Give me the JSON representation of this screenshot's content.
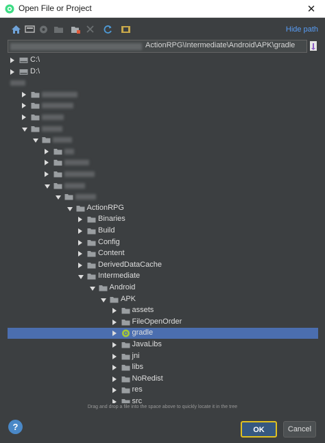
{
  "window": {
    "title": "Open File or Project",
    "close_glyph": "✕"
  },
  "toolbar": {
    "icons": [
      "home-icon",
      "desktop-icon",
      "android-icon",
      "project-folder-icon",
      "new-folder-icon",
      "delete-icon",
      "refresh-icon",
      "show-hidden-icon"
    ],
    "hide_path_label": "Hide path"
  },
  "path": {
    "visible_text": "ActionRPG\\Intermediate\\Android\\APK\\gradle"
  },
  "tree": {
    "rows": [
      {
        "label": "C:\\",
        "level": 0,
        "arrow": "right",
        "icon": "drive"
      },
      {
        "label": "D:\\",
        "level": 0,
        "arrow": "right",
        "icon": "drive"
      },
      {
        "label": "",
        "level": 0,
        "arrow": "",
        "icon": "",
        "blurred": true
      },
      {
        "label": "",
        "level": 1,
        "arrow": "right",
        "icon": "folder",
        "blurred": true
      },
      {
        "label": "",
        "level": 1,
        "arrow": "right",
        "icon": "folder",
        "blurred": true
      },
      {
        "label": "",
        "level": 1,
        "arrow": "right",
        "icon": "folder",
        "blurred": true
      },
      {
        "label": "",
        "level": 1,
        "arrow": "down",
        "icon": "folder",
        "blurred": true
      },
      {
        "label": "",
        "level": 2,
        "arrow": "down",
        "icon": "folder",
        "blurred": true
      },
      {
        "label": "",
        "level": 3,
        "arrow": "right",
        "icon": "folder",
        "blurred": true
      },
      {
        "label": "",
        "level": 3,
        "arrow": "right",
        "icon": "folder",
        "blurred": true
      },
      {
        "label": "",
        "level": 3,
        "arrow": "right",
        "icon": "folder",
        "blurred": true
      },
      {
        "label": "",
        "level": 3,
        "arrow": "down",
        "icon": "folder",
        "blurred": true
      },
      {
        "label": "",
        "level": 4,
        "arrow": "down",
        "icon": "folder",
        "blurred": true
      },
      {
        "label": "ActionRPG",
        "level": 5,
        "arrow": "down",
        "icon": "folder"
      },
      {
        "label": "Binaries",
        "level": 6,
        "arrow": "right",
        "icon": "folder"
      },
      {
        "label": "Build",
        "level": 6,
        "arrow": "right",
        "icon": "folder"
      },
      {
        "label": "Config",
        "level": 6,
        "arrow": "right",
        "icon": "folder"
      },
      {
        "label": "Content",
        "level": 6,
        "arrow": "right",
        "icon": "folder"
      },
      {
        "label": "DerivedDataCache",
        "level": 6,
        "arrow": "right",
        "icon": "folder"
      },
      {
        "label": "Intermediate",
        "level": 6,
        "arrow": "down",
        "icon": "folder"
      },
      {
        "label": "Android",
        "level": 7,
        "arrow": "down",
        "icon": "folder"
      },
      {
        "label": "APK",
        "level": 8,
        "arrow": "down",
        "icon": "folder"
      },
      {
        "label": "assets",
        "level": 9,
        "arrow": "right",
        "icon": "folder"
      },
      {
        "label": "FileOpenOrder",
        "level": 9,
        "arrow": "right",
        "icon": "folder"
      },
      {
        "label": "gradle",
        "level": 9,
        "arrow": "right",
        "icon": "android",
        "selected": true
      },
      {
        "label": "JavaLibs",
        "level": 9,
        "arrow": "right",
        "icon": "folder"
      },
      {
        "label": "jni",
        "level": 9,
        "arrow": "right",
        "icon": "folder"
      },
      {
        "label": "libs",
        "level": 9,
        "arrow": "right",
        "icon": "folder"
      },
      {
        "label": "NoRedist",
        "level": 9,
        "arrow": "right",
        "icon": "folder"
      },
      {
        "label": "res",
        "level": 9,
        "arrow": "right",
        "icon": "folder"
      },
      {
        "label": "src",
        "level": 9,
        "arrow": "right",
        "icon": "folder"
      }
    ]
  },
  "hint": "Drag and drop a file into the space above to quickly locate it in the tree",
  "footer": {
    "help_glyph": "?",
    "ok_label": "OK",
    "cancel_label": "Cancel"
  },
  "colors": {
    "background": "#3c3f41",
    "selection": "#4b6eaf",
    "link": "#589df6",
    "ok_focus_border": "#e0c020"
  }
}
